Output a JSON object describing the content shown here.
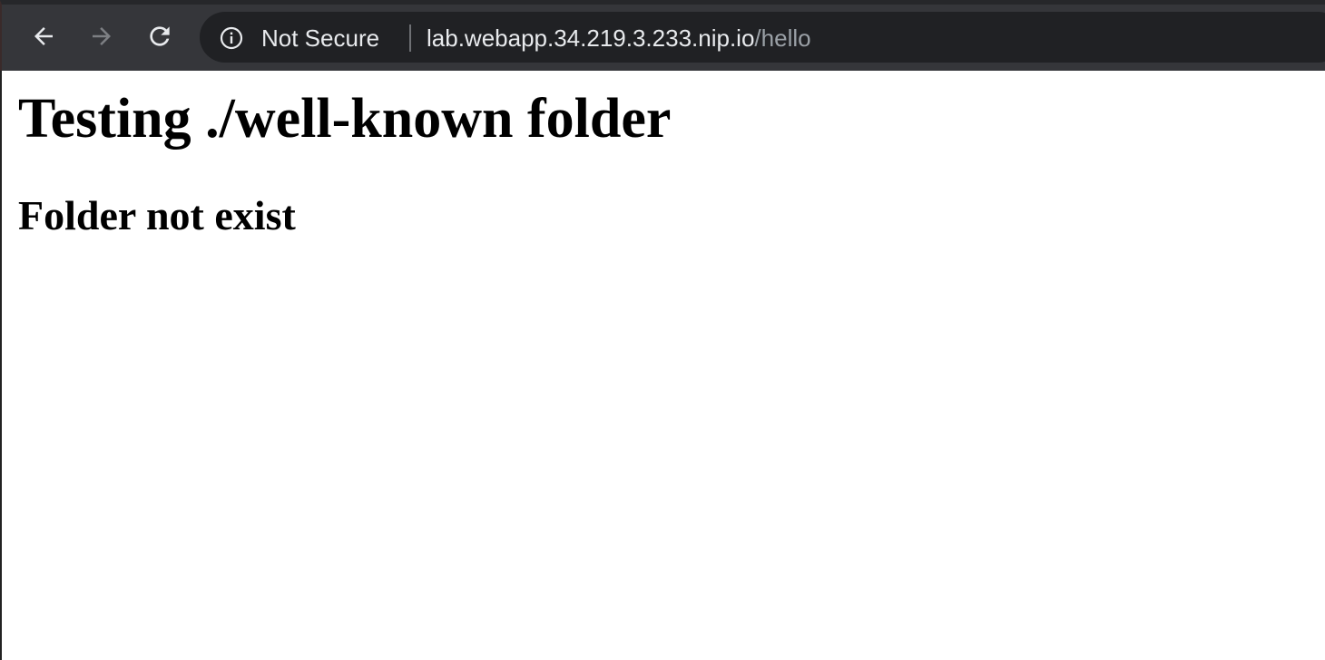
{
  "browser": {
    "toolbar": {
      "back_icon": "arrow-left-icon",
      "forward_icon": "arrow-right-icon",
      "reload_icon": "reload-icon",
      "forward_enabled": false
    },
    "address_bar": {
      "security_icon": "info-circle-icon",
      "security_label": "Not Secure",
      "url_host": "lab.webapp.34.219.3.233.nip.io",
      "url_path": "/hello"
    },
    "colors": {
      "chrome_background": "#35363a",
      "omnibox_background": "#202124",
      "text_primary": "#e8eaed",
      "text_secondary": "#9aa0a6"
    }
  },
  "page": {
    "heading": "Testing ./well-known folder",
    "subheading": "Folder not exist"
  }
}
